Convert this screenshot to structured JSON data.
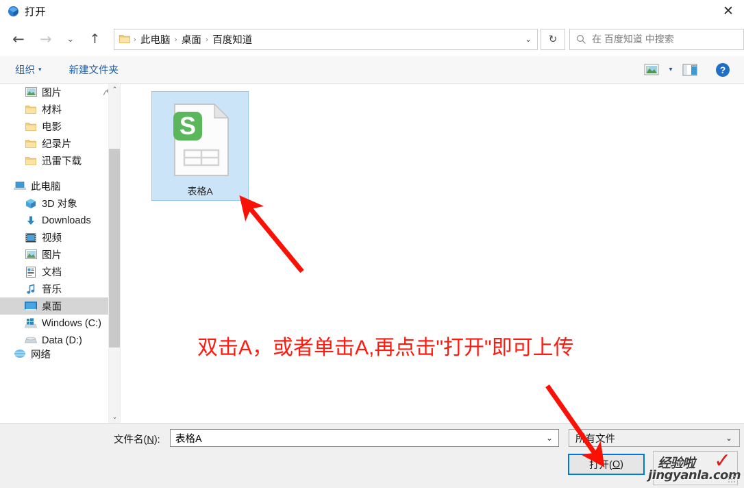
{
  "window": {
    "title": "打开",
    "title_icon": "open-dialog-icon",
    "close_label": "✕"
  },
  "nav": {
    "back_icon": "←",
    "forward_icon": "→",
    "recent_icon": "⌄",
    "up_icon": "↑",
    "refresh_icon": "↻",
    "address_caret": "⌄",
    "crumb_sep": "›",
    "breadcrumbs": [
      {
        "label": "此电脑"
      },
      {
        "label": "桌面"
      },
      {
        "label": "百度知道"
      }
    ]
  },
  "search": {
    "placeholder": "在 百度知道 中搜索",
    "icon": "search-icon"
  },
  "toolbar": {
    "organize_label": "组织",
    "organize_caret": "▾",
    "new_folder_label": "新建文件夹",
    "view_caret": "▾",
    "icons": [
      "view-mode-icon",
      "preview-pane-icon",
      "help-icon"
    ]
  },
  "sidebar": {
    "scroll_up": "⌃",
    "scroll_down": "⌄",
    "items": [
      {
        "label": "图片",
        "icon": "pictures-icon",
        "indent": true,
        "pinned": true,
        "selected": false
      },
      {
        "label": "材料",
        "icon": "folder-icon",
        "indent": true,
        "pinned": false,
        "selected": false
      },
      {
        "label": "电影",
        "icon": "folder-icon",
        "indent": true,
        "pinned": false,
        "selected": false
      },
      {
        "label": "纪录片",
        "icon": "folder-icon",
        "indent": true,
        "pinned": false,
        "selected": false
      },
      {
        "label": "迅雷下载",
        "icon": "folder-icon",
        "indent": true,
        "pinned": false,
        "selected": false
      },
      {
        "label": "此电脑",
        "icon": "this-pc-icon",
        "indent": false,
        "pinned": false,
        "selected": false
      },
      {
        "label": "3D 对象",
        "icon": "3d-objects-icon",
        "indent": true,
        "pinned": false,
        "selected": false
      },
      {
        "label": "Downloads",
        "icon": "downloads-icon",
        "indent": true,
        "pinned": false,
        "selected": false
      },
      {
        "label": "视频",
        "icon": "videos-icon",
        "indent": true,
        "pinned": false,
        "selected": false
      },
      {
        "label": "图片",
        "icon": "pictures-icon",
        "indent": true,
        "pinned": false,
        "selected": false
      },
      {
        "label": "文档",
        "icon": "documents-icon",
        "indent": true,
        "pinned": false,
        "selected": false
      },
      {
        "label": "音乐",
        "icon": "music-icon",
        "indent": true,
        "pinned": false,
        "selected": false
      },
      {
        "label": "桌面",
        "icon": "desktop-icon",
        "indent": true,
        "pinned": false,
        "selected": true
      },
      {
        "label": "Windows (C:)",
        "icon": "windows-drive-icon",
        "indent": true,
        "pinned": false,
        "selected": false
      },
      {
        "label": "Data (D:)",
        "icon": "drive-icon",
        "indent": true,
        "pinned": false,
        "selected": false
      },
      {
        "label": "网络",
        "icon": "network-icon",
        "indent": false,
        "pinned": false,
        "selected": false
      }
    ]
  },
  "files": [
    {
      "name": "表格A",
      "icon": "wps-spreadsheet-icon",
      "selected": true
    }
  ],
  "footer": {
    "filename_label_pre": "文件名(",
    "filename_label_key": "N",
    "filename_label_post": "):",
    "filename_value": "表格A",
    "filename_caret": "⌄",
    "filetype_value": "所有文件",
    "filetype_caret": "⌄",
    "open_label_pre": "打开(",
    "open_label_key": "O",
    "open_label_post": ")"
  },
  "annotation": {
    "text": "双击A，或者单击A,再点击\"打开\"即可上传",
    "color": "#ff1a10"
  },
  "watermark": {
    "brand": "经验啦",
    "url": "jingyanla.com",
    "check": "✓"
  },
  "colors": {
    "selection_fill": "#cce4f7",
    "selection_border": "#99c9ef",
    "focus_border": "#0078d7",
    "sidebar_selected": "#d5d5d5",
    "link_blue": "#1c5ca8",
    "annotation_red": "#ff1a10"
  }
}
